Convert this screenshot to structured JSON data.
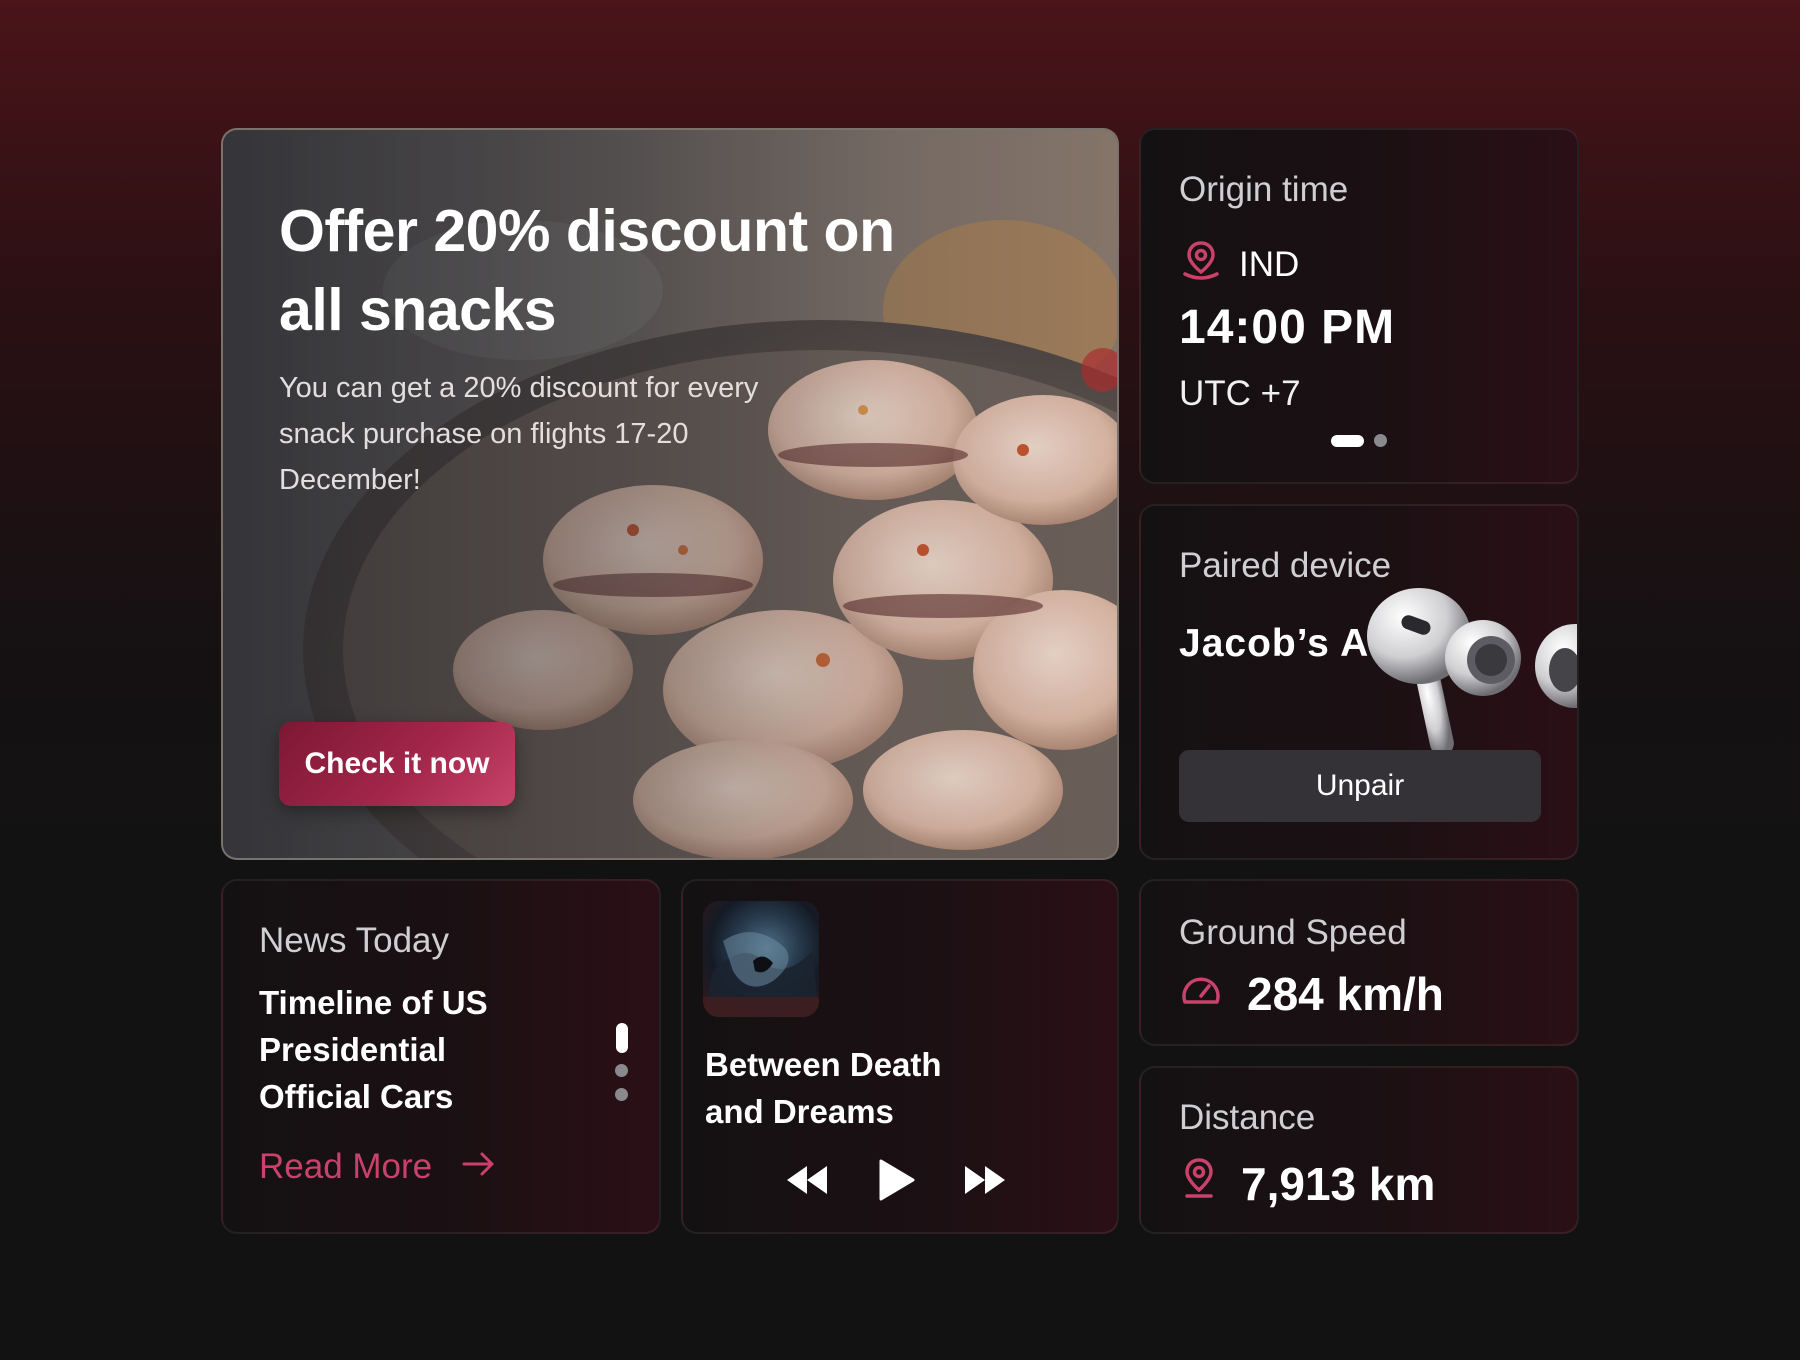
{
  "promo": {
    "title": "Offer 20% discount on all snacks",
    "description": "You can get a 20% discount for every snack purchase on flights 17-20 December!",
    "cta_label": "Check it now"
  },
  "origin": {
    "title": "Origin time",
    "location": "IND",
    "time": "14:00 PM",
    "timezone": "UTC +7",
    "page_index": 1,
    "page_count": 2
  },
  "paired": {
    "title": "Paired device",
    "device_name": "Jacob’s Airpods",
    "unpair_label": "Unpair"
  },
  "news": {
    "title": "News Today",
    "headline": "Timeline of US Presidential Official Cars",
    "read_more_label": "Read More",
    "page_index": 1,
    "page_count": 3
  },
  "music": {
    "song_title": "Between Death and Dreams"
  },
  "speed": {
    "title": "Ground Speed",
    "value": "284 km/h"
  },
  "distance": {
    "title": "Distance",
    "value": "7,913 km"
  },
  "colors": {
    "accent": "#c9416c",
    "cta_start": "#7c1734",
    "cta_end": "#c8436a"
  },
  "icons": {
    "origin": "location-pin-icon",
    "speed": "speedometer-icon",
    "distance": "location-pin-icon",
    "read_more": "arrow-right-icon",
    "controls": [
      "rewind-icon",
      "play-icon",
      "fast-forward-icon"
    ]
  }
}
